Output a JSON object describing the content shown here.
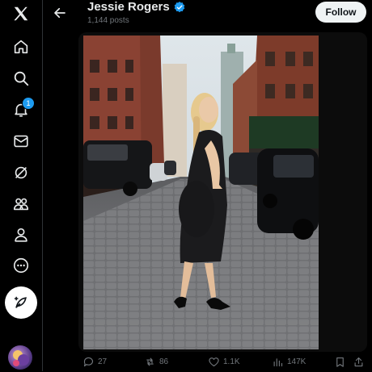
{
  "header": {
    "name": "Jessie Rogers",
    "posts_count": "1,144 posts",
    "follow_label": "Follow",
    "verified": true
  },
  "sidebar": {
    "items": [
      {
        "icon": "x-logo-icon"
      },
      {
        "icon": "home-icon"
      },
      {
        "icon": "search-icon"
      },
      {
        "icon": "notifications-icon",
        "badge": "1"
      },
      {
        "icon": "messages-icon"
      },
      {
        "icon": "grok-icon"
      },
      {
        "icon": "communities-icon"
      },
      {
        "icon": "profile-icon"
      },
      {
        "icon": "more-icon"
      }
    ],
    "post_button_icon": "compose-icon"
  },
  "actions": {
    "replies": "27",
    "reposts": "86",
    "likes": "1.1K",
    "views": "147K"
  },
  "colors": {
    "accent": "#1d9bf0",
    "background": "#000000",
    "muted": "#71767b"
  }
}
